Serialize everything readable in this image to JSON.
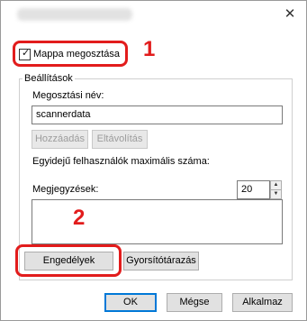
{
  "titlebar": {
    "close_symbol": "✕"
  },
  "share": {
    "checkbox_label": "Mappa megosztása",
    "checked": true,
    "checkmark": "✓"
  },
  "annotations": {
    "marker1": "1",
    "marker2": "2",
    "color": "#e21c1c"
  },
  "settings": {
    "group_label": "Beállítások",
    "share_name_label": "Megosztási név:",
    "share_name_value": "scannerdata",
    "add_button": "Hozzáadás",
    "remove_button": "Eltávolítás",
    "max_users_label": "Egyidejű felhasználók maximális száma:",
    "max_users_value": "20",
    "comments_label": "Megjegyzések:",
    "comments_value": "",
    "permissions_button": "Engedélyek",
    "caching_button": "Gyorsítótárazás"
  },
  "footer": {
    "ok": "OK",
    "cancel": "Mégse",
    "apply": "Alkalmaz"
  },
  "spinner": {
    "up": "▲",
    "down": "▼"
  }
}
